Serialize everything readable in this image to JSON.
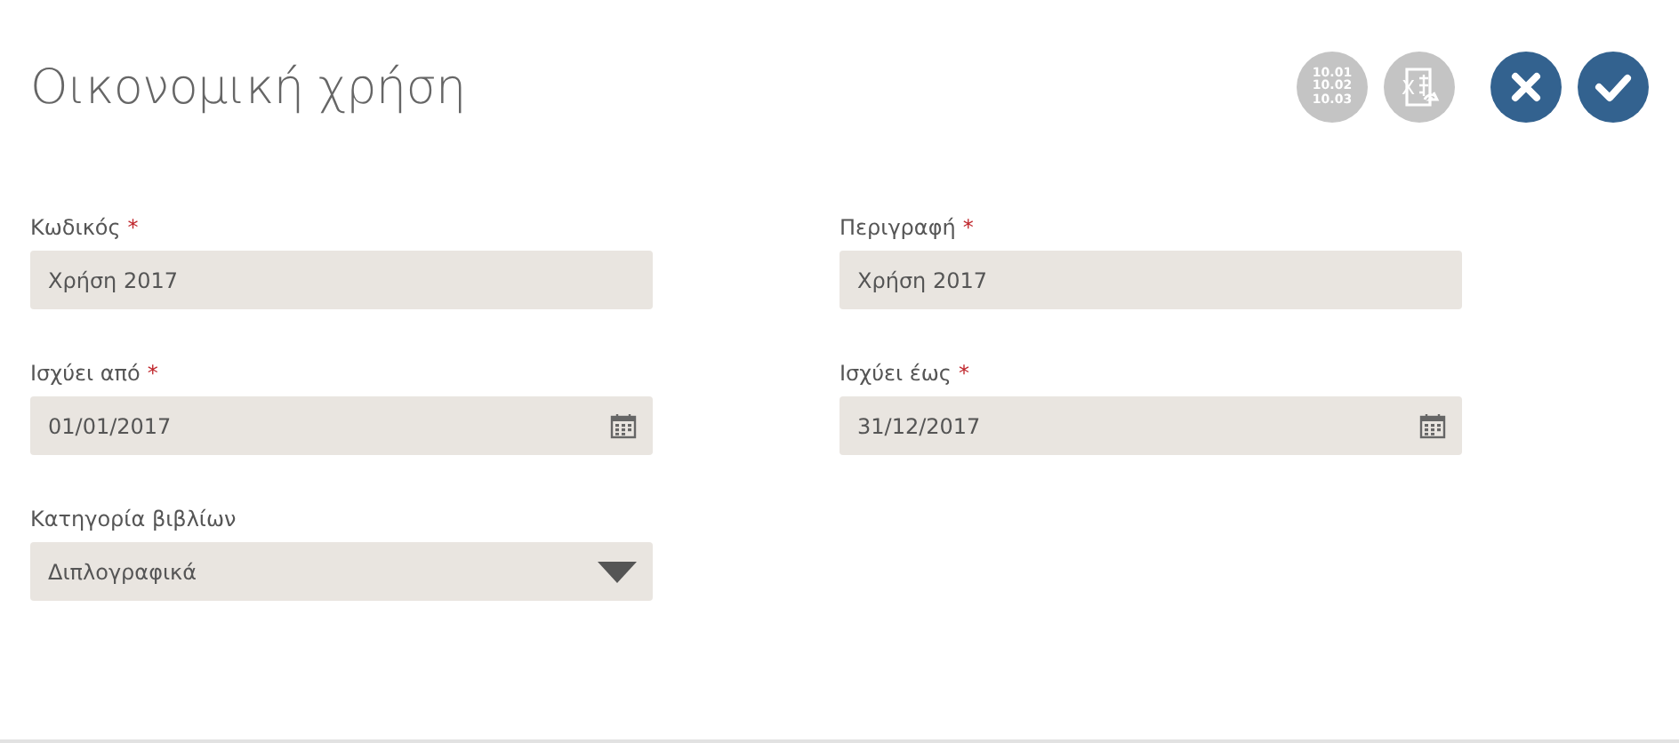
{
  "title": "Οικονομική χρήση",
  "toolbar": [
    {
      "kind": "numbers",
      "lines": [
        "10.01",
        "10.02",
        "10.03"
      ],
      "disabled": true
    },
    {
      "kind": "excel",
      "letter": "X",
      "disabled": true
    },
    {
      "kind": "cancel",
      "disabled": false
    },
    {
      "kind": "confirm",
      "disabled": false
    }
  ],
  "fields": [
    {
      "label": "Κωδικός",
      "required": true,
      "kind": "text",
      "value": "Χρήση 2017"
    },
    {
      "label": "Περιγραφή",
      "required": true,
      "kind": "text",
      "value": "Χρήση 2017"
    },
    {
      "label": "Ισχύει από",
      "required": true,
      "kind": "date",
      "value": "01/01/2017"
    },
    {
      "label": "Ισχύει έως",
      "required": true,
      "kind": "date",
      "value": "31/12/2017"
    },
    {
      "label": "Κατηγορία βιβλίων",
      "required": false,
      "kind": "select",
      "value": "Διπλογραφικά"
    }
  ],
  "required_mark": "*"
}
